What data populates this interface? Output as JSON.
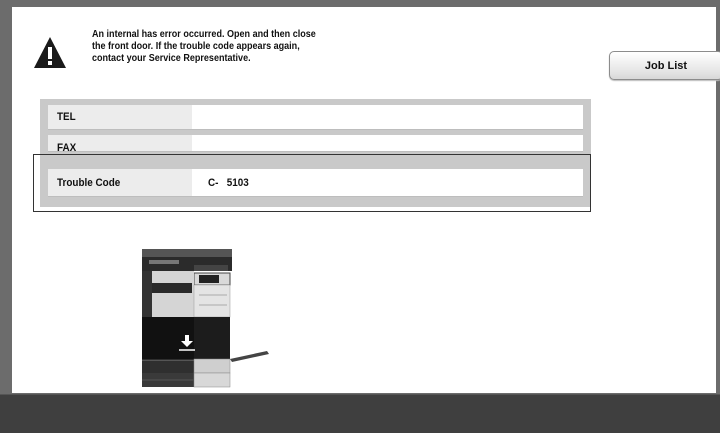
{
  "message": {
    "text": "An internal has error occurred. Open and then close\nthe front door.  If the trouble code appears again,\ncontact your Service Representative."
  },
  "job_list_button": {
    "label": "Job List"
  },
  "info_rows": {
    "tel": {
      "label": "TEL",
      "value": ""
    },
    "fax": {
      "label": "FAX",
      "value": ""
    },
    "trouble_code": {
      "label": "Trouble Code",
      "value": "C-   5103"
    }
  },
  "icons": [
    "warning-icon",
    "copier-machine-illustration"
  ],
  "colors": {
    "frame_background": "#6c6c6c",
    "screen_background": "#ffffff",
    "panel_gray": "#c9c9c9",
    "bottom_bar": "#3f3f3f"
  }
}
